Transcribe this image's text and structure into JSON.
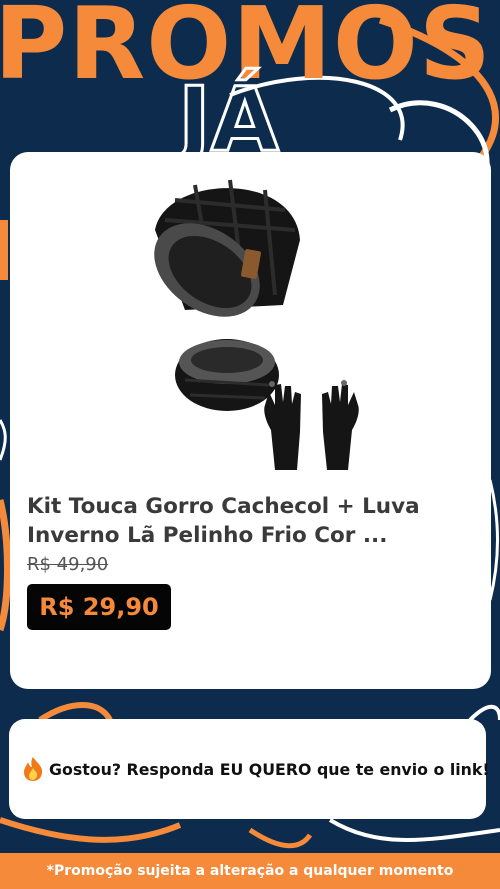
{
  "banner": {
    "headline": "PROMOS",
    "subhead": "JÁ"
  },
  "product": {
    "image_alt": "Kit touca gorro, cachecol e luvas pretos",
    "title": "Kit Touca Gorro Cachecol + Luva Inverno Lã Pelinho Frio Cor ...",
    "old_price": "R$ 49,90",
    "price": "R$ 29,90"
  },
  "cta": {
    "emoji_icon": "fire-icon",
    "text": "Gostou? Responda EU QUERO que te envio o link!"
  },
  "footer": {
    "disclaimer": "*Promoção sujeita a alteração a qualquer momento"
  },
  "colors": {
    "background": "#0c2b4d",
    "accent": "#f48a3a",
    "card": "#ffffff",
    "price_tag": "#050505"
  }
}
